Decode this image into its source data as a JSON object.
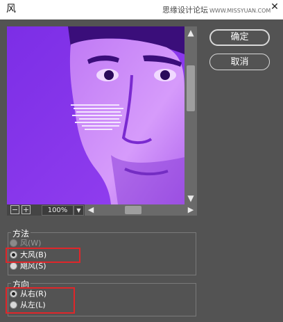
{
  "window": {
    "title": "风",
    "watermark_text": "思缘设计论坛",
    "watermark_url": "WWW.MISSYUAN.COM",
    "close_glyph": "✕"
  },
  "preview": {
    "icon": "portrait-preview-image",
    "tint_color": "#8a35ec"
  },
  "zoom": {
    "out_glyph": "−",
    "in_glyph": "+",
    "value": "100%",
    "dropdown_glyph": "▼"
  },
  "scroll": {
    "up": "▲",
    "down": "▼",
    "left": "◀",
    "right": "▶"
  },
  "buttons": {
    "ok": "确定",
    "cancel": "取消"
  },
  "method": {
    "title": "方法",
    "options": [
      {
        "label": "风(W)",
        "selected": false
      },
      {
        "label": "大风(B)",
        "selected": true
      },
      {
        "label": "飓风(S)",
        "selected": false
      }
    ]
  },
  "direction": {
    "title": "方向",
    "options": [
      {
        "label": "从右(R)",
        "selected": true
      },
      {
        "label": "从左(L)",
        "selected": false
      }
    ]
  },
  "colors": {
    "dialog_bg": "#535353",
    "highlight": "#e0262a"
  }
}
